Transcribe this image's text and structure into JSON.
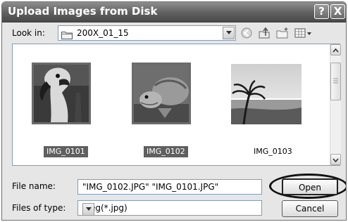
{
  "window": {
    "title": "Upload Images from Disk",
    "help_symbol": "?",
    "close_symbol": "X"
  },
  "look_in": {
    "label": "Look in:",
    "value": "200X_01_15"
  },
  "toolbar_icons": [
    "back-icon",
    "up-folder-icon",
    "new-folder-icon",
    "view-menu-icon"
  ],
  "files": [
    {
      "name": "IMG_0101",
      "selected": true
    },
    {
      "name": "IMG_0102",
      "selected": true
    },
    {
      "name": "IMG_0103",
      "selected": false
    }
  ],
  "file_name": {
    "label": "File name:",
    "value": "\"IMG_0102.JPG\" \"IMG_0101.JPG\""
  },
  "file_type": {
    "label": "Files of type:",
    "value": "jpeg(*.jpg)"
  },
  "buttons": {
    "open": "Open",
    "cancel": "Cancel"
  },
  "colors": {
    "titlebar": "#5f5f5f",
    "selection": "#5f5f5f"
  }
}
